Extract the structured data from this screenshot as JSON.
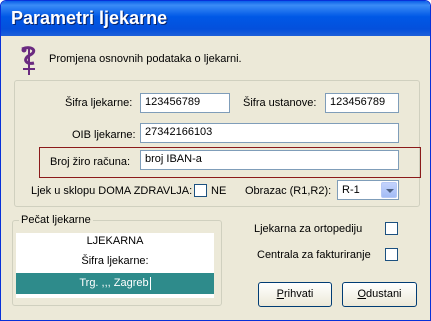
{
  "window": {
    "title": "Parametri ljekarne"
  },
  "header": {
    "subtitle": "Promjena osnovnih podataka o ljekarni."
  },
  "form": {
    "sifra_ljekarne_label": "Šifra ljekarne:",
    "sifra_ljekarne_value": "123456789",
    "sifra_ustanove_label": "Šifra ustanove:",
    "sifra_ustanove_value": "123456789",
    "oib_label": "OIB ljekarne:",
    "oib_value": "27342166103",
    "ziro_label": "Broj žiro računa:",
    "ziro_value": "broj IBAN-a",
    "doma_zdravlja_label": "Ljek u sklopu DOMA ZDRAVLJA:",
    "doma_zdravlja_checkbox_text": "NE",
    "obrazac_label": "Obrazac (R1,R2):",
    "obrazac_value": "R-1"
  },
  "stamp": {
    "legend": "Pečat ljekarne",
    "lines": [
      "LJEKARNA",
      "Šifra ljekarne:",
      "Trg. ,,, Zagreb"
    ]
  },
  "options": {
    "ortopedija_label": "Ljekarna za ortopediju",
    "fakturiranje_label": "Centrala za fakturiranje"
  },
  "buttons": {
    "prihvati_underline": "P",
    "prihvati_rest": "rihvati",
    "odustani_underline": "O",
    "odustani_rest": "dustani"
  },
  "colors": {
    "accent_frame": "#8b1a1a",
    "selection": "#2e8b8b",
    "titlebar": "#0058e6"
  }
}
